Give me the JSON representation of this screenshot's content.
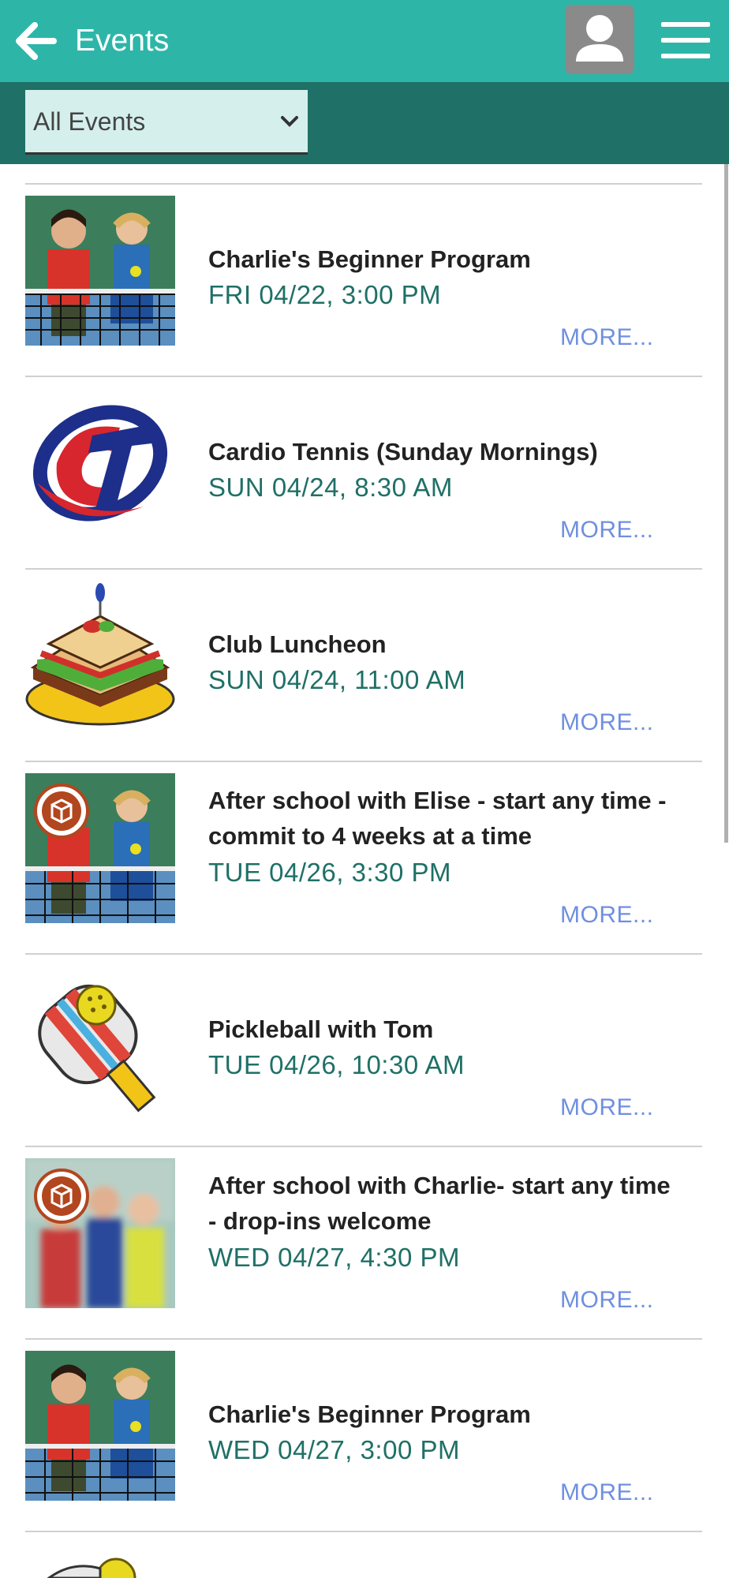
{
  "header": {
    "title": "Events",
    "back_icon": "arrow-left-icon",
    "avatar_icon": "user-icon",
    "menu_icon": "hamburger-menu-icon",
    "color": "#2db6a8"
  },
  "filter": {
    "selected": "All Events",
    "icon": "chevron-down-icon",
    "bar_color": "#1f7066"
  },
  "events": [
    {
      "title": "Charlie's Beginner Program",
      "date": "FRI 04/22, 3:00 PM",
      "more": "MORE...",
      "image": "kids-tennis-image",
      "badge": false
    },
    {
      "title": "Cardio Tennis (Sunday Mornings)",
      "date": "SUN 04/24, 8:30 AM",
      "more": "MORE...",
      "image": "cardio-tennis-logo",
      "badge": false
    },
    {
      "title": "Club Luncheon",
      "date": "SUN 04/24, 11:00 AM",
      "more": "MORE...",
      "image": "sandwich-image",
      "badge": false
    },
    {
      "title": "After school with Elise - start any time - commit to 4 weeks at a time",
      "date": "TUE 04/26, 3:30 PM",
      "more": "MORE...",
      "image": "kids-tennis-image",
      "badge": true
    },
    {
      "title": "Pickleball with Tom",
      "date": "TUE 04/26, 10:30 AM",
      "more": "MORE...",
      "image": "pickleball-paddle-image",
      "badge": false
    },
    {
      "title": "After school with Charlie- start any time - drop-ins welcome",
      "date": "WED 04/27, 4:30 PM",
      "more": "MORE...",
      "image": "blurred-kids-image",
      "badge": true
    },
    {
      "title": "Charlie's Beginner Program",
      "date": "WED 04/27, 3:00 PM",
      "more": "MORE...",
      "image": "kids-tennis-image",
      "badge": false
    }
  ]
}
